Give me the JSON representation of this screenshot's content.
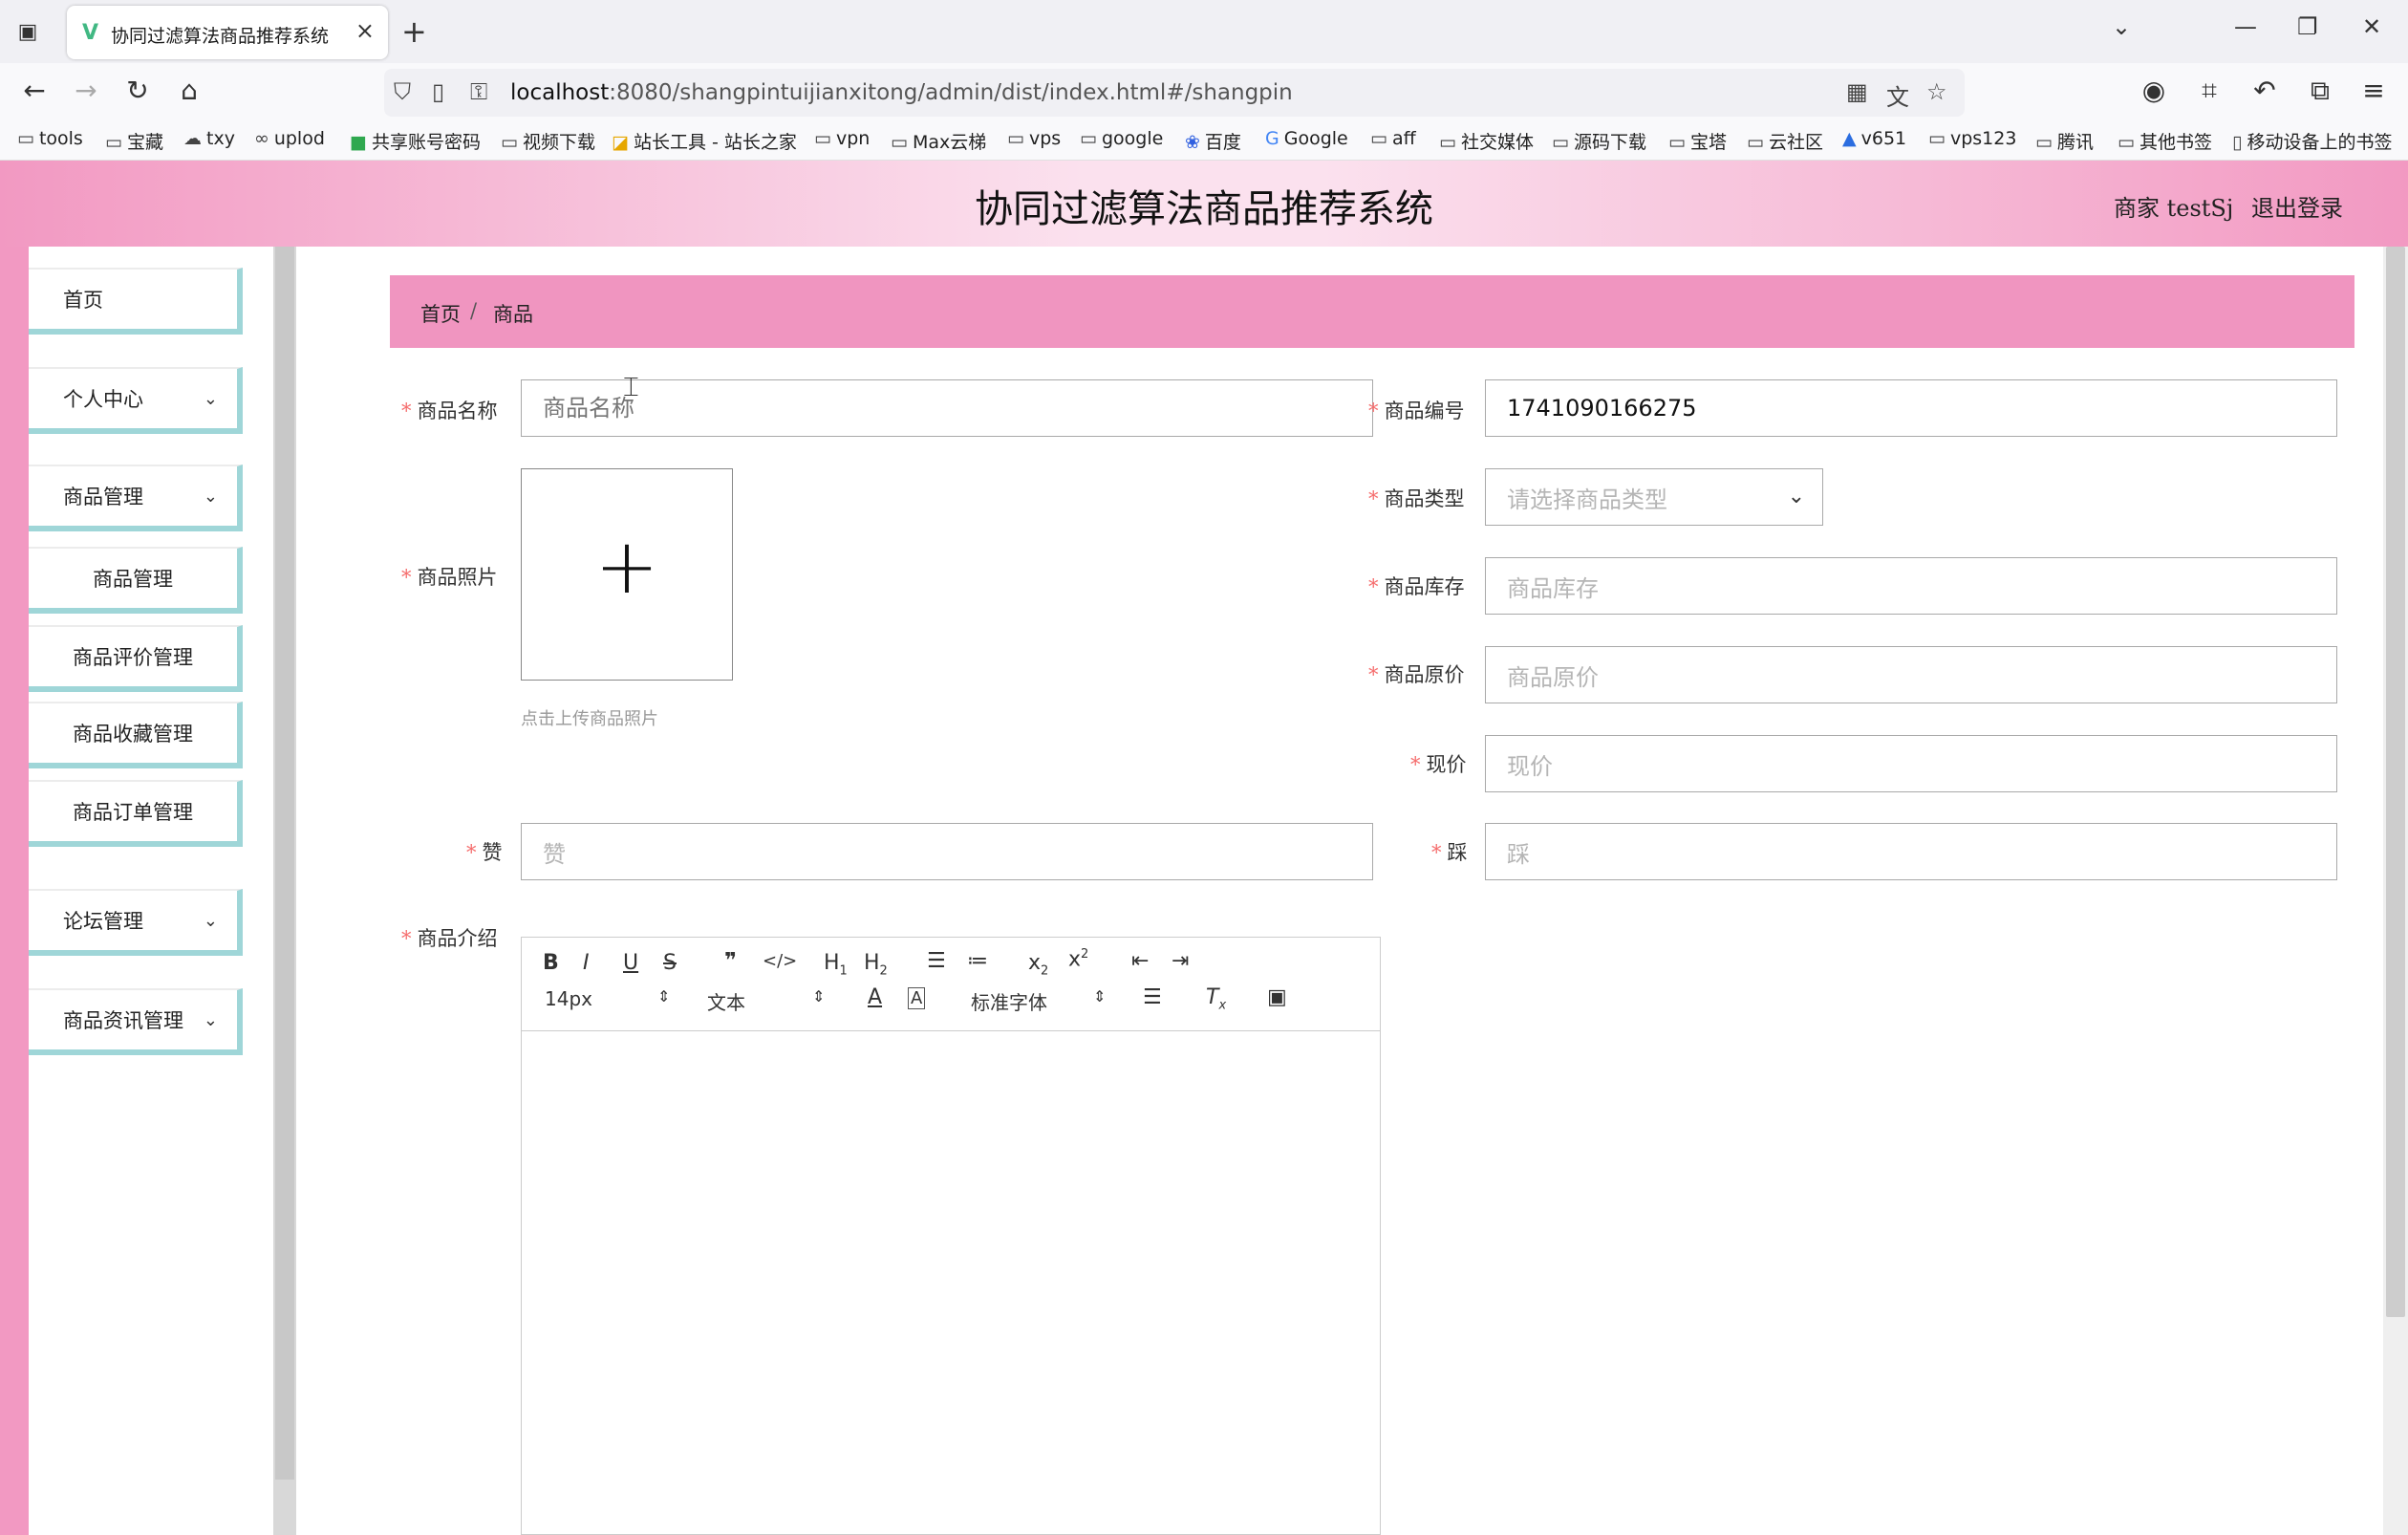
{
  "browser": {
    "tab_title": "协同过滤算法商品推荐系统",
    "url_host": "localhost",
    "url_rest": ":8080/shangpintuijianxitong/admin/dist/index.html#/shangpin",
    "bookmarks": [
      "tools",
      "宝藏",
      "txy",
      "uplod",
      "共享账号密码",
      "视频下载",
      "站长工具 - 站长之家",
      "vpn",
      "Max云梯",
      "vps",
      "google",
      "百度",
      "Google",
      "aff",
      "社交媒体",
      "源码下载",
      "宝塔",
      "云社区",
      "v651",
      "vps123",
      "腾讯",
      "其他书签",
      "移动设备上的书签"
    ]
  },
  "header": {
    "title": "协同过滤算法商品推荐系统",
    "user": "商家 testSj",
    "logout": "退出登录"
  },
  "sidebar": {
    "items": [
      {
        "label": "首页"
      },
      {
        "label": "个人中心"
      },
      {
        "label": "商品管理"
      },
      {
        "label": "商品管理"
      },
      {
        "label": "商品评价管理"
      },
      {
        "label": "商品收藏管理"
      },
      {
        "label": "商品订单管理"
      },
      {
        "label": "论坛管理"
      },
      {
        "label": "商品资讯管理"
      }
    ]
  },
  "breadcrumb": {
    "home": "首页",
    "sep": "/",
    "current": "商品"
  },
  "form": {
    "name_label": "商品名称",
    "name_placeholder": "商品名称",
    "code_label": "商品编号",
    "code_value": "1741090166275",
    "photo_label": "商品照片",
    "photo_hint": "点击上传商品照片",
    "type_label": "商品类型",
    "type_placeholder": "请选择商品类型",
    "stock_label": "商品库存",
    "stock_placeholder": "商品库存",
    "orig_price_label": "商品原价",
    "orig_price_placeholder": "商品原价",
    "price_label": "现价",
    "price_placeholder": "现价",
    "like_label": "赞",
    "like_placeholder": "赞",
    "dislike_label": "踩",
    "dislike_placeholder": "踩",
    "intro_label": "商品介绍"
  },
  "editor": {
    "font_size": "14px",
    "header_select": "文本",
    "font_family": "标准字体"
  },
  "colors": {
    "pink": "#f299c2",
    "teal_border": "#9fd6d8",
    "required": "#f56c6c"
  }
}
